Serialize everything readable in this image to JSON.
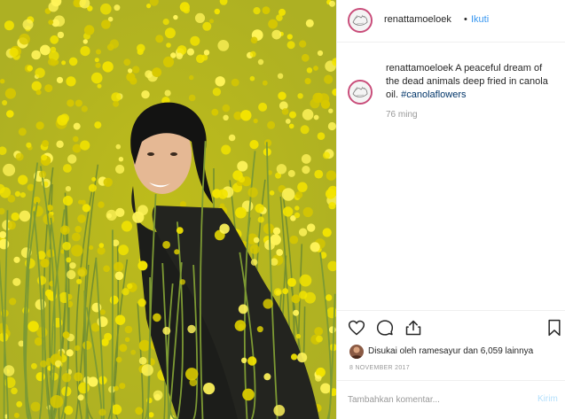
{
  "post": {
    "username": "renattamoeloek",
    "separator": "•",
    "follow_label": "Ikuti",
    "caption_username": "renattamoeloek",
    "caption_text": "A peaceful dream of the dead animals deep fried in canola oil.",
    "hashtag": "#canolaflowers",
    "time_ago": "76 ming",
    "likes_text": "Disukai oleh ramesayur dan 6,059 lainnya",
    "date": "8 NOVEMBER 2017",
    "comment_placeholder": "Tambahkan komentar...",
    "post_label": "Kirim"
  },
  "icons": [
    "heart-icon",
    "comment-icon",
    "share-icon",
    "bookmark-icon"
  ],
  "colors": {
    "link": "#3897f0",
    "hashtag": "#003569",
    "muted": "#999999",
    "post_disabled": "#b2dffc",
    "flower_yellow": "#f3e400",
    "stem_green": "#7d9a33"
  }
}
